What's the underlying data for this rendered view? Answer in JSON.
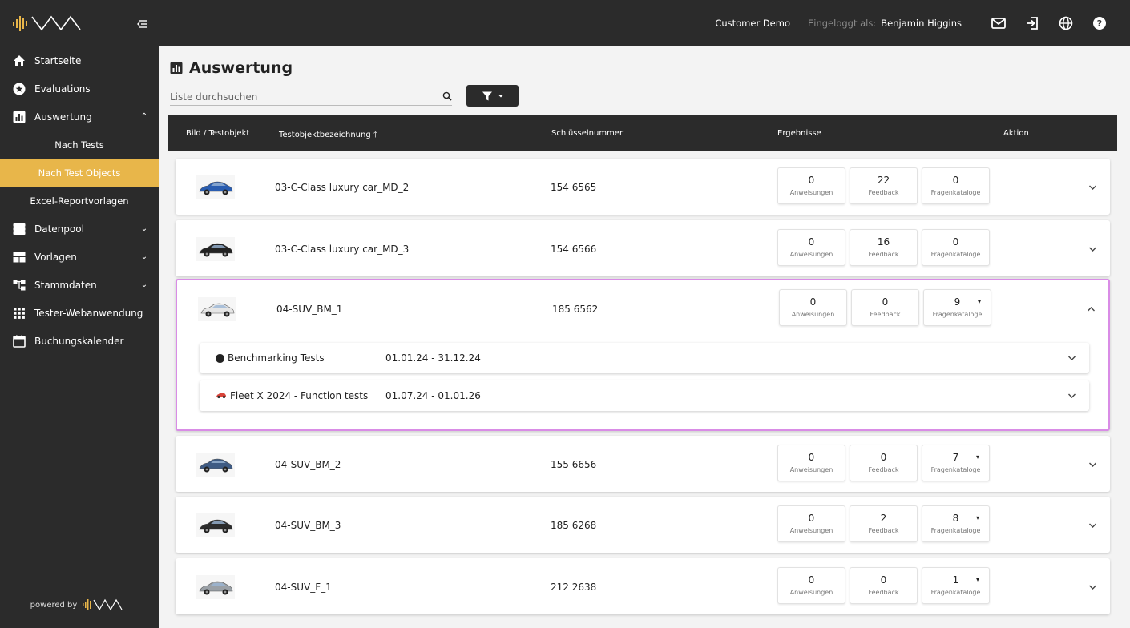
{
  "brand": {
    "powered_by": "powered by"
  },
  "topbar": {
    "customer": "Customer Demo",
    "logged_in_label": "Eingeloggt als:",
    "user": "Benjamin Higgins"
  },
  "sidebar": {
    "items": [
      {
        "label": "Startseite"
      },
      {
        "label": "Evaluations"
      },
      {
        "label": "Auswertung"
      },
      {
        "label": "Datenpool"
      },
      {
        "label": "Vorlagen"
      },
      {
        "label": "Stammdaten"
      },
      {
        "label": "Tester-Webanwendung"
      },
      {
        "label": "Buchungskalender"
      }
    ],
    "sub_items": [
      {
        "label": "Nach Tests"
      },
      {
        "label": "Nach Test Objects",
        "active": true
      },
      {
        "label": "Excel-Reportvorlagen"
      }
    ]
  },
  "page": {
    "title": "Auswertung"
  },
  "search": {
    "placeholder": "Liste durchsuchen"
  },
  "table": {
    "headers": [
      "Bild / Testobjekt",
      "Testobjektbezeichnung",
      "Schlüsselnummer",
      "Ergebnisse",
      "Aktion"
    ],
    "metric_labels": [
      "Anweisungen",
      "Feedback",
      "Fragenkataloge"
    ],
    "rows": [
      {
        "name": "03-C-Class luxury car_MD_2",
        "key": "154 6565",
        "anweisungen": "0",
        "feedback": "22",
        "fragenkataloge": "0",
        "car_color": "#2a5db0"
      },
      {
        "name": "03-C-Class luxury car_MD_3",
        "key": "154 6566",
        "anweisungen": "0",
        "feedback": "16",
        "fragenkataloge": "0",
        "car_color": "#222222"
      },
      {
        "name": "04-SUV_BM_1",
        "key": "185 6562",
        "anweisungen": "0",
        "feedback": "0",
        "fragenkataloge": "9",
        "car_color": "#e6e6e6",
        "sub_rows": [
          {
            "title": "Benchmarking Tests",
            "dates": "01.01.24 - 31.12.24"
          },
          {
            "title": "Fleet X 2024 - Function tests",
            "dates": "01.07.24 - 01.01.26"
          }
        ]
      },
      {
        "name": "04-SUV_BM_2",
        "key": "155 6656",
        "anweisungen": "0",
        "feedback": "0",
        "fragenkataloge": "7",
        "car_color": "#3e5b84"
      },
      {
        "name": "04-SUV_BM_3",
        "key": "185 6268",
        "anweisungen": "0",
        "feedback": "2",
        "fragenkataloge": "8",
        "car_color": "#2c2c2c"
      },
      {
        "name": "04-SUV_F_1",
        "key": "212 2638",
        "anweisungen": "0",
        "feedback": "0",
        "fragenkataloge": "1",
        "car_color": "#9aa0a6"
      }
    ]
  },
  "colors": {
    "dark": "#2b2b2b",
    "accent": "#e8b64a",
    "highlight_border": "#d98ce6"
  }
}
